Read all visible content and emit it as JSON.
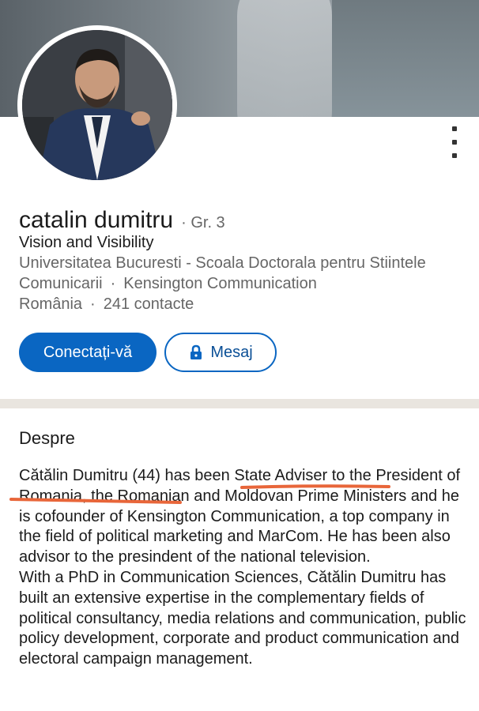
{
  "profile": {
    "name": "catalin dumitru",
    "degree": "Gr. 3",
    "headline": "Vision and Visibility",
    "education_line_1": "Universitatea Bucuresti - Scoala Doctorala pentru Stiintele",
    "education_line_2_school": "Comunicarii",
    "company": "Kensington Communication",
    "country": "România",
    "contacts": "241 contacte",
    "separator": "·"
  },
  "actions": {
    "connect_label": "Conectați-vă",
    "message_label": "Mesaj",
    "connect_color": "#0a66c2"
  },
  "about": {
    "title": "Despre",
    "paragraph_1": "Cătălin Dumitru (44) has been State Adviser to the President of Romania, the Romanian and Moldovan Prime Ministers and he is cofounder of Kensington Communication, a top company in the field of political marketing and MarCom. He has been also advisor to the presindent of the national television.",
    "paragraph_2": "With a PhD in Communication Sciences, Cătălin Dumitru has built an extensive expertise in the complementary fields of political consultancy, media relations and communication, public policy development, corporate and product communication and electoral campaign management."
  },
  "icons": {
    "menu": "more-vertical-icon",
    "lock": "lock-icon"
  },
  "annotation_color": "#e8663a"
}
